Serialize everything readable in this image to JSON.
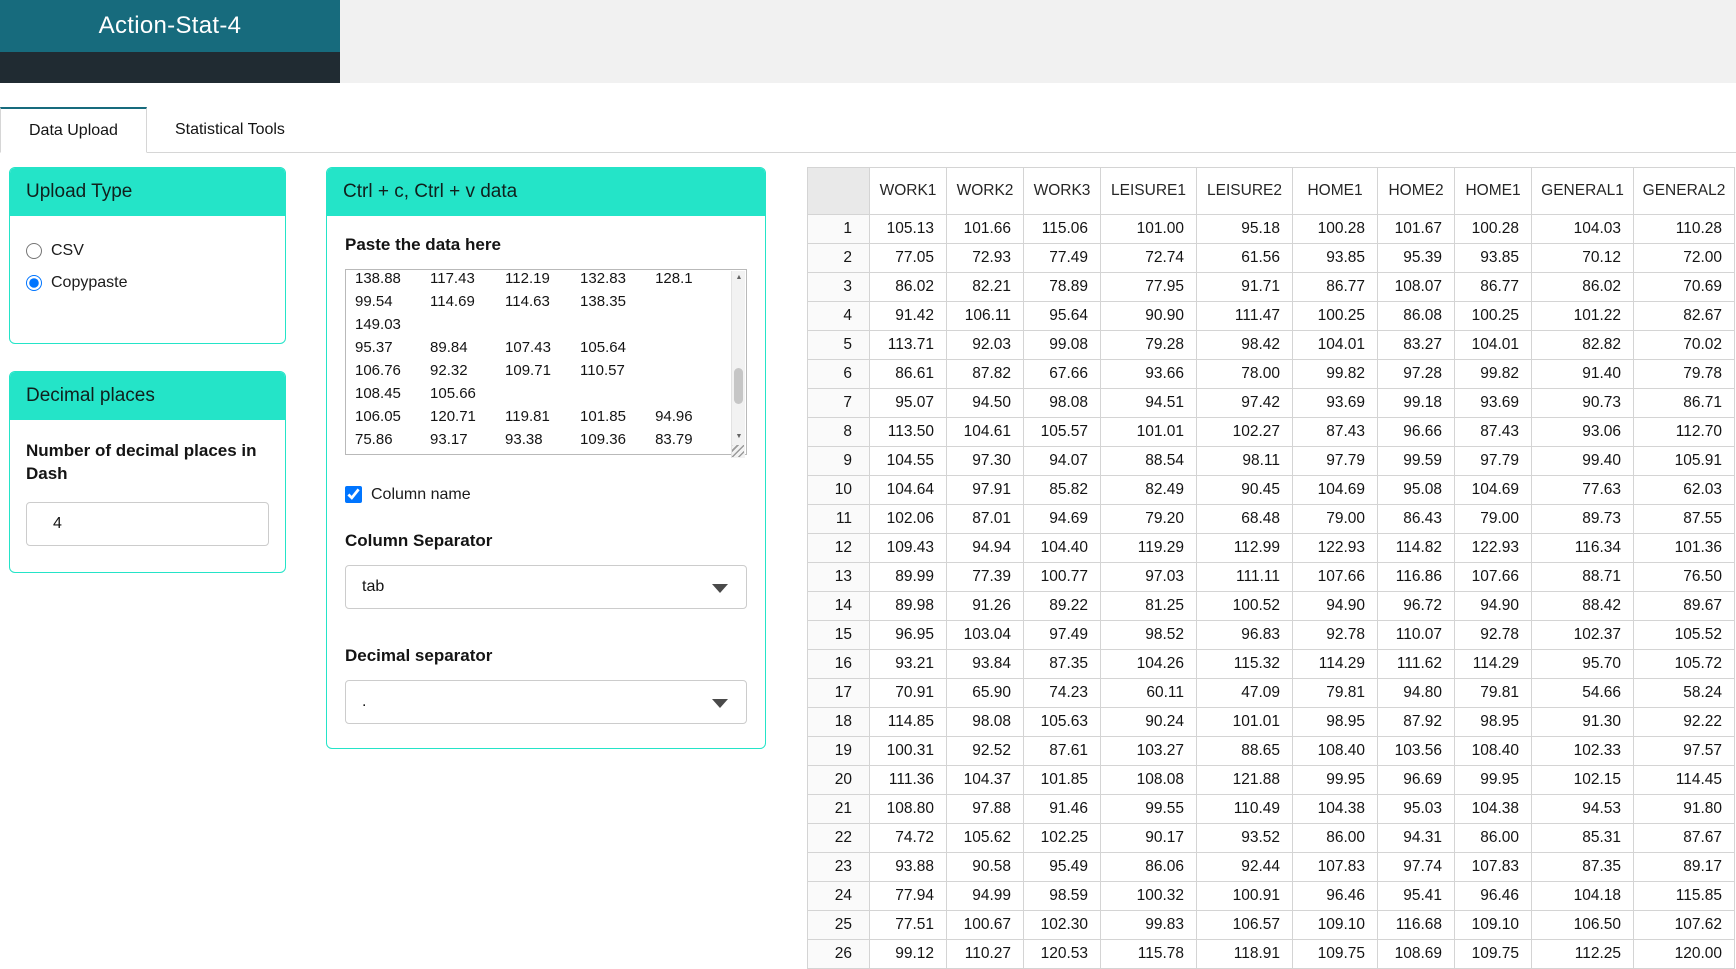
{
  "header": {
    "app_title": "Action-Stat-4"
  },
  "tabs": [
    {
      "label": "Data Upload",
      "active": true
    },
    {
      "label": "Statistical Tools",
      "active": false
    }
  ],
  "upload_type_card": {
    "title": "Upload Type",
    "options": [
      {
        "label": "CSV",
        "selected": false
      },
      {
        "label": "Copypaste",
        "selected": true
      }
    ]
  },
  "decimal_places_card": {
    "title": "Decimal places",
    "label": "Number of decimal places in Dash",
    "value": "4"
  },
  "paste_card": {
    "title": "Ctrl + c, Ctrl + v data",
    "paste_label": "Paste the data here",
    "textarea_text": "138.88\t117.43\t112.19\t132.83\t128.1\n99.54\t114.69\t114.63\t138.35\n149.03\n95.37\t89.84\t107.43\t105.64\n106.76\t92.32\t109.71\t110.57\n108.45\t105.66\n106.05\t120.71\t119.81\t101.85\t94.96\n75.86\t93.17\t93.38\t109.36\t83.79",
    "column_name_checkbox": {
      "label": "Column name",
      "checked": true
    },
    "column_separator_label": "Column Separator",
    "column_separator_value": "tab",
    "decimal_separator_label": "Decimal separator",
    "decimal_separator_value": "."
  },
  "icons": {
    "scroll_up_arrow": "▲",
    "scroll_down_arrow": "▼"
  },
  "colors": {
    "accent_teal": "#176b7d",
    "card_cyan": "#24e4c8"
  },
  "table": {
    "columns": [
      "",
      "WORK1",
      "WORK2",
      "WORK3",
      "LEISURE1",
      "LEISURE2",
      "HOME1",
      "HOME2",
      "HOME1",
      "GENERAL1",
      "GENERAL2"
    ],
    "rows": [
      [
        "1",
        "105.13",
        "101.66",
        "115.06",
        "101.00",
        "95.18",
        "100.28",
        "101.67",
        "100.28",
        "104.03",
        "110.28"
      ],
      [
        "2",
        "77.05",
        "72.93",
        "77.49",
        "72.74",
        "61.56",
        "93.85",
        "95.39",
        "93.85",
        "70.12",
        "72.00"
      ],
      [
        "3",
        "86.02",
        "82.21",
        "78.89",
        "77.95",
        "91.71",
        "86.77",
        "108.07",
        "86.77",
        "86.02",
        "70.69"
      ],
      [
        "4",
        "91.42",
        "106.11",
        "95.64",
        "90.90",
        "111.47",
        "100.25",
        "86.08",
        "100.25",
        "101.22",
        "82.67"
      ],
      [
        "5",
        "113.71",
        "92.03",
        "99.08",
        "79.28",
        "98.42",
        "104.01",
        "83.27",
        "104.01",
        "82.82",
        "70.02"
      ],
      [
        "6",
        "86.61",
        "87.82",
        "67.66",
        "93.66",
        "78.00",
        "99.82",
        "97.28",
        "99.82",
        "91.40",
        "79.78"
      ],
      [
        "7",
        "95.07",
        "94.50",
        "98.08",
        "94.51",
        "97.42",
        "93.69",
        "99.18",
        "93.69",
        "90.73",
        "86.71"
      ],
      [
        "8",
        "113.50",
        "104.61",
        "105.57",
        "101.01",
        "102.27",
        "87.43",
        "96.66",
        "87.43",
        "93.06",
        "112.70"
      ],
      [
        "9",
        "104.55",
        "97.30",
        "94.07",
        "88.54",
        "98.11",
        "97.79",
        "99.59",
        "97.79",
        "99.40",
        "105.91"
      ],
      [
        "10",
        "104.64",
        "97.91",
        "85.82",
        "82.49",
        "90.45",
        "104.69",
        "95.08",
        "104.69",
        "77.63",
        "62.03"
      ],
      [
        "11",
        "102.06",
        "87.01",
        "94.69",
        "79.20",
        "68.48",
        "79.00",
        "86.43",
        "79.00",
        "89.73",
        "87.55"
      ],
      [
        "12",
        "109.43",
        "94.94",
        "104.40",
        "119.29",
        "112.99",
        "122.93",
        "114.82",
        "122.93",
        "116.34",
        "101.36"
      ],
      [
        "13",
        "89.99",
        "77.39",
        "100.77",
        "97.03",
        "111.11",
        "107.66",
        "116.86",
        "107.66",
        "88.71",
        "76.50"
      ],
      [
        "14",
        "89.98",
        "91.26",
        "89.22",
        "81.25",
        "100.52",
        "94.90",
        "96.72",
        "94.90",
        "88.42",
        "89.67"
      ],
      [
        "15",
        "96.95",
        "103.04",
        "97.49",
        "98.52",
        "96.83",
        "92.78",
        "110.07",
        "92.78",
        "102.37",
        "105.52"
      ],
      [
        "16",
        "93.21",
        "93.84",
        "87.35",
        "104.26",
        "115.32",
        "114.29",
        "111.62",
        "114.29",
        "95.70",
        "105.72"
      ],
      [
        "17",
        "70.91",
        "65.90",
        "74.23",
        "60.11",
        "47.09",
        "79.81",
        "94.80",
        "79.81",
        "54.66",
        "58.24"
      ],
      [
        "18",
        "114.85",
        "98.08",
        "105.63",
        "90.24",
        "101.01",
        "98.95",
        "87.92",
        "98.95",
        "91.30",
        "92.22"
      ],
      [
        "19",
        "100.31",
        "92.52",
        "87.61",
        "103.27",
        "88.65",
        "108.40",
        "103.56",
        "108.40",
        "102.33",
        "97.57"
      ],
      [
        "20",
        "111.36",
        "104.37",
        "101.85",
        "108.08",
        "121.88",
        "99.95",
        "96.69",
        "99.95",
        "102.15",
        "114.45"
      ],
      [
        "21",
        "108.80",
        "97.88",
        "91.46",
        "99.55",
        "110.49",
        "104.38",
        "95.03",
        "104.38",
        "94.53",
        "91.80"
      ],
      [
        "22",
        "74.72",
        "105.62",
        "102.25",
        "90.17",
        "93.52",
        "86.00",
        "94.31",
        "86.00",
        "85.31",
        "87.67"
      ],
      [
        "23",
        "93.88",
        "90.58",
        "95.49",
        "86.06",
        "92.44",
        "107.83",
        "97.74",
        "107.83",
        "87.35",
        "89.17"
      ],
      [
        "24",
        "77.94",
        "94.99",
        "98.59",
        "100.32",
        "100.91",
        "96.46",
        "95.41",
        "96.46",
        "104.18",
        "115.85"
      ],
      [
        "25",
        "77.51",
        "100.67",
        "102.30",
        "99.83",
        "106.57",
        "109.10",
        "116.68",
        "109.10",
        "106.50",
        "107.62"
      ],
      [
        "26",
        "99.12",
        "110.27",
        "120.53",
        "115.78",
        "118.91",
        "109.75",
        "108.69",
        "109.75",
        "112.25",
        "120.00"
      ]
    ]
  }
}
